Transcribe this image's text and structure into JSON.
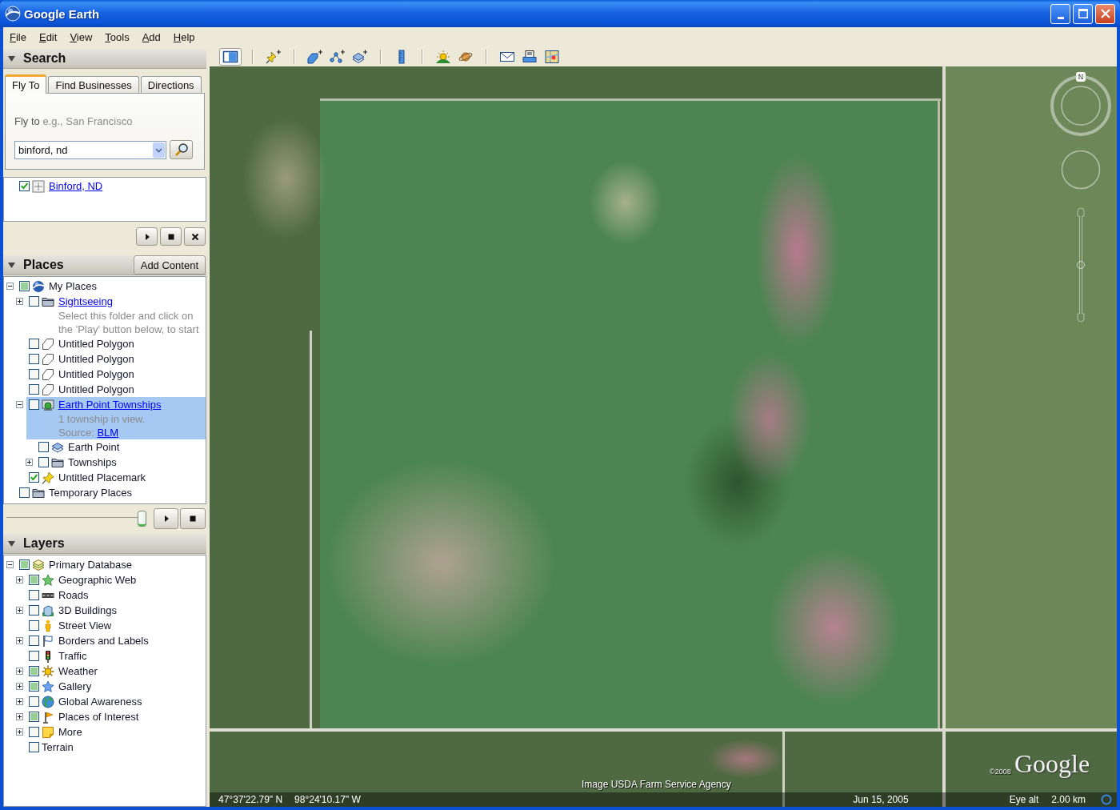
{
  "window": {
    "title": "Google Earth"
  },
  "menu": [
    "File",
    "Edit",
    "View",
    "Tools",
    "Add",
    "Help"
  ],
  "toolbar": {
    "groups": [
      [
        {
          "kind": "sidebar",
          "on": true
        }
      ],
      [
        {
          "kind": "placemark",
          "on": false
        }
      ],
      [
        {
          "kind": "polygon",
          "on": false
        },
        {
          "kind": "path",
          "on": false
        },
        {
          "kind": "overlay",
          "on": false
        }
      ],
      [
        {
          "kind": "ruler",
          "on": false
        }
      ],
      [
        {
          "kind": "sunlight",
          "on": false
        },
        {
          "kind": "sky",
          "on": false
        }
      ],
      [
        {
          "kind": "email",
          "on": false
        },
        {
          "kind": "print",
          "on": false
        },
        {
          "kind": "maps",
          "on": false
        }
      ]
    ]
  },
  "search": {
    "title": "Search",
    "tabs": [
      {
        "label": "Fly To",
        "selected": true
      },
      {
        "label": "Find Businesses",
        "selected": false
      },
      {
        "label": "Directions",
        "selected": false
      }
    ],
    "prompt": "Fly to",
    "hint": "e.g., San Francisco",
    "query": {
      "value": "binford, nd"
    },
    "results": [
      {
        "label": "Binford, ND",
        "kind": "search-result",
        "link": true,
        "checked": true,
        "partial": false,
        "selected": false
      }
    ]
  },
  "places": {
    "title": "Places",
    "add_content": "Add Content",
    "tree": [
      {
        "label": "My Places",
        "kind": "earth-logo",
        "link": false,
        "checked": false,
        "partial": true,
        "expanded": true,
        "selected": false,
        "children": [
          {
            "label": "Sightseeing",
            "kind": "folder",
            "link": true,
            "checked": false,
            "partial": false,
            "expanded": false,
            "selected": false,
            "description": [
              {
                "text": "Select this folder and click on"
              },
              {
                "text": "the 'Play' button below, to start"
              }
            ]
          },
          {
            "label": "Untitled Polygon",
            "kind": "polygon",
            "link": false,
            "checked": false,
            "partial": false,
            "selected": false
          },
          {
            "label": "Untitled Polygon",
            "kind": "polygon",
            "link": false,
            "checked": false,
            "partial": false,
            "selected": false
          },
          {
            "label": "Untitled Polygon",
            "kind": "polygon",
            "link": false,
            "checked": false,
            "partial": false,
            "selected": false
          },
          {
            "label": "Untitled Polygon",
            "kind": "polygon",
            "link": false,
            "checked": false,
            "partial": false,
            "selected": false
          },
          {
            "label": "Earth Point Townships",
            "kind": "network-link",
            "link": true,
            "checked": false,
            "partial": false,
            "expanded": true,
            "selected": true,
            "description": [
              {
                "text": "1 township in view."
              },
              {
                "text": "Source:",
                "link": "BLM"
              }
            ],
            "children": [
              {
                "label": "Earth Point",
                "kind": "overlay",
                "link": false,
                "checked": false,
                "partial": false,
                "selected": false
              },
              {
                "label": "Townships",
                "kind": "folder",
                "link": false,
                "checked": false,
                "partial": false,
                "expanded": false,
                "selected": false
              }
            ]
          },
          {
            "label": "Untitled Placemark",
            "kind": "placemark",
            "link": false,
            "checked": true,
            "partial": false,
            "selected": false
          }
        ]
      },
      {
        "label": "Temporary Places",
        "kind": "folder",
        "link": false,
        "checked": false,
        "partial": false,
        "selected": false
      }
    ],
    "tour_slider": {
      "level": 1
    }
  },
  "layers": {
    "title": "Layers",
    "tree": [
      {
        "label": "Primary Database",
        "kind": "database",
        "link": false,
        "checked": false,
        "partial": true,
        "expanded": true,
        "selected": false,
        "children": [
          {
            "label": "Geographic Web",
            "kind": "green-star",
            "link": false,
            "checked": false,
            "partial": true,
            "expanded": false,
            "selected": false
          },
          {
            "label": "Roads",
            "kind": "road",
            "link": false,
            "checked": false,
            "partial": false,
            "selected": false
          },
          {
            "label": "3D Buildings",
            "kind": "buildings",
            "link": false,
            "checked": false,
            "partial": false,
            "expanded": false,
            "selected": false
          },
          {
            "label": "Street View",
            "kind": "person",
            "link": false,
            "checked": false,
            "partial": false,
            "selected": false
          },
          {
            "label": "Borders and Labels",
            "kind": "borders",
            "link": false,
            "checked": false,
            "partial": false,
            "expanded": false,
            "selected": false
          },
          {
            "label": "Traffic",
            "kind": "traffic",
            "link": false,
            "checked": false,
            "partial": false,
            "selected": false
          },
          {
            "label": "Weather",
            "kind": "sun",
            "link": false,
            "checked": false,
            "partial": true,
            "expanded": false,
            "selected": false
          },
          {
            "label": "Gallery",
            "kind": "blue-star",
            "link": false,
            "checked": false,
            "partial": true,
            "expanded": false,
            "selected": false
          },
          {
            "label": "Global Awareness",
            "kind": "globe",
            "link": false,
            "checked": false,
            "partial": false,
            "expanded": false,
            "selected": false
          },
          {
            "label": "Places of Interest",
            "kind": "poi-flag",
            "link": false,
            "checked": false,
            "partial": true,
            "expanded": false,
            "selected": false
          },
          {
            "label": "More",
            "kind": "note",
            "link": false,
            "checked": false,
            "partial": false,
            "expanded": false,
            "selected": false
          },
          {
            "label": "Terrain",
            "kind": "plain",
            "link": false,
            "checked": false,
            "partial": false,
            "selected": false
          }
        ]
      }
    ]
  },
  "map": {
    "north": "N",
    "zoom_slider": {
      "level": 0.5
    },
    "imagery_credit": "Image USDA Farm Service Agency",
    "copyright": "©2008",
    "logo": "Google",
    "latitude": "47°37'22.79\" N",
    "longitude": "98°24'10.17\" W",
    "date": "Jun 15, 2005",
    "eye_alt_label": "Eye alt",
    "eye_alt": "2.00 km"
  }
}
